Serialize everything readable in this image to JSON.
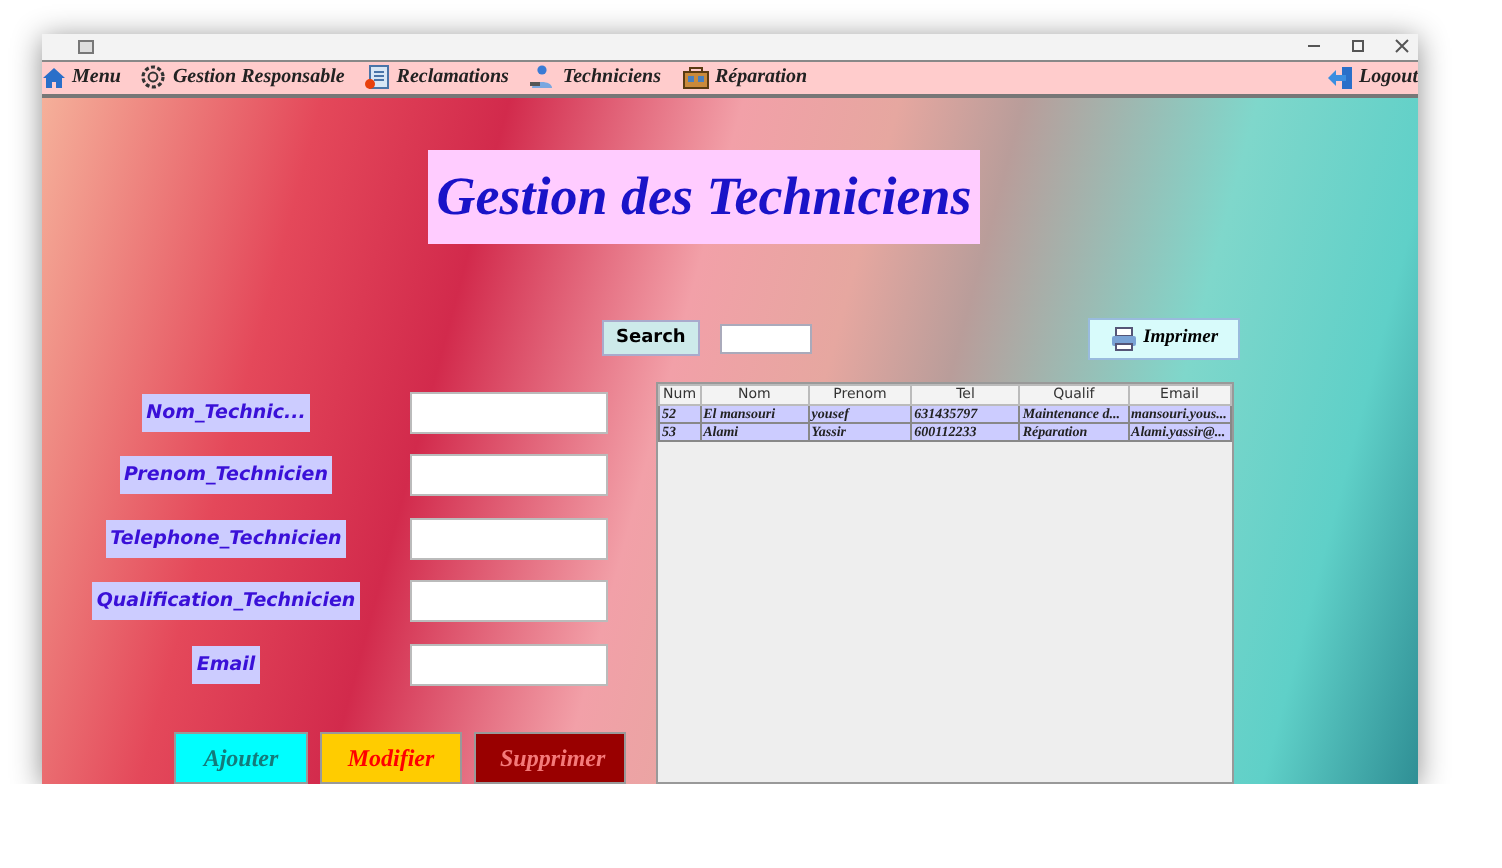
{
  "menu": [
    {
      "label": "Menu",
      "kind": "home"
    },
    {
      "label": "Gestion Responsable",
      "kind": "gear"
    },
    {
      "label": "Reclamations",
      "kind": "document"
    },
    {
      "label": "Techniciens",
      "kind": "people"
    },
    {
      "label": "Réparation",
      "kind": "toolbox"
    }
  ],
  "logout": {
    "label": "Logout"
  },
  "heading": "Gestion des Techniciens",
  "search": {
    "label": "Search"
  },
  "print_button": "Imprimer",
  "form": [
    {
      "label": "Nom_Technic..."
    },
    {
      "label": "Prenom_Technicien"
    },
    {
      "label": "Telephone_Technicien"
    },
    {
      "label": "Qualification_Technicien"
    },
    {
      "label": "Email"
    }
  ],
  "table": {
    "columns": [
      "Num",
      "Nom",
      "Prenom",
      "Tel",
      "Qualif",
      "Email"
    ],
    "rows": [
      [
        "52",
        "El mansouri",
        "yousef",
        "631435797",
        "Maintenance d...",
        "mansouri.yous..."
      ],
      [
        "53",
        "Alami",
        "Yassir",
        "600112233",
        "Réparation",
        "Alami.yassir@..."
      ]
    ]
  },
  "buttons": [
    {
      "label": "Ajouter",
      "kind": "add"
    },
    {
      "label": "Modifier",
      "kind": "edit"
    },
    {
      "label": "Supprimer",
      "kind": "delete"
    }
  ]
}
